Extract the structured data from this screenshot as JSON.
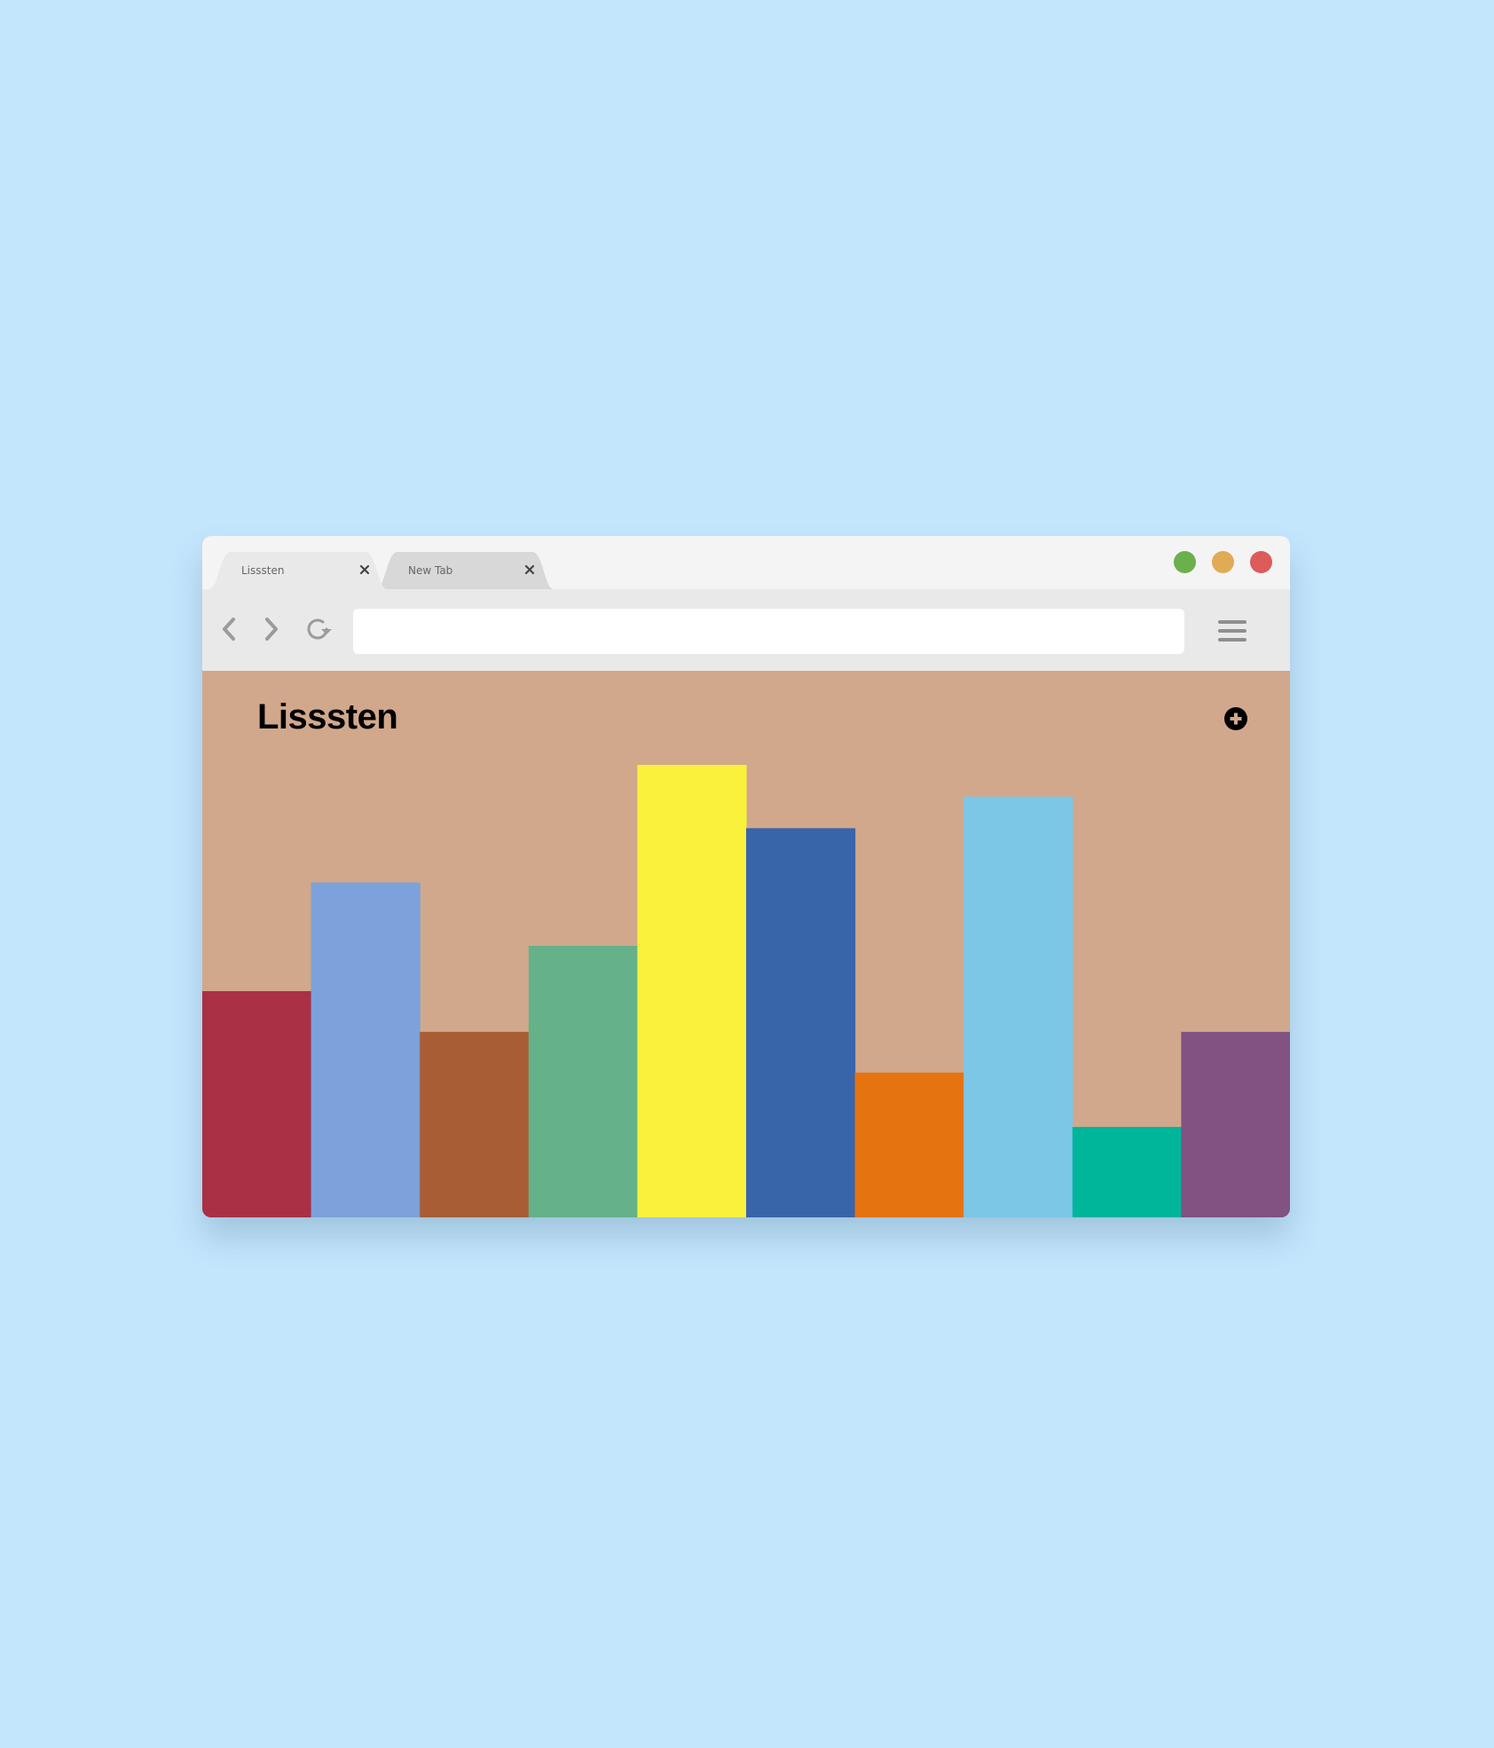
{
  "browser": {
    "tabs": [
      {
        "label": "Lisssten",
        "active": true
      },
      {
        "label": "New Tab",
        "active": false
      }
    ],
    "window_controls": [
      {
        "name": "green-window-button",
        "color": "#6ab04c"
      },
      {
        "name": "yellow-window-button",
        "color": "#e1aa55"
      },
      {
        "name": "red-window-button",
        "color": "#dd5b5b"
      }
    ],
    "toolbar": {
      "back_icon": "chevron-left-icon",
      "forward_icon": "chevron-right-icon",
      "reload_icon": "reload-icon",
      "address_value": "",
      "menu_icon": "hamburger-menu-icon"
    }
  },
  "page": {
    "title": "Lisssten",
    "add_icon": "plus-circle-icon",
    "background": "#d1a88c"
  },
  "chart_data": {
    "type": "bar",
    "title": "",
    "xlabel": "",
    "ylabel": "",
    "ylim": [
      0,
      100
    ],
    "grid": false,
    "values": [
      50,
      74,
      41,
      60,
      100,
      86,
      32,
      93,
      20,
      41
    ],
    "colors": [
      "#aa3046",
      "#7ca1db",
      "#a95d35",
      "#65b18a",
      "#f9f13b",
      "#3864aa",
      "#e5730f",
      "#7cc6e6",
      "#00b69a",
      "#815282"
    ]
  }
}
